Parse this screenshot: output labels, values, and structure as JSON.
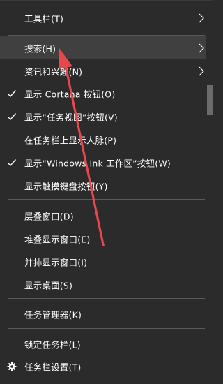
{
  "menu": {
    "items": [
      {
        "label": "工具栏(T)",
        "submenu": true
      },
      {
        "label": "搜索(H)",
        "submenu": true,
        "highlighted": true
      },
      {
        "label": "资讯和兴趣(N)",
        "submenu": true
      },
      {
        "label": "显示 Cortana 按钮(O)",
        "checked": true
      },
      {
        "label": "显示“任务视图”按钮(V)",
        "checked": true
      },
      {
        "label": "在任务栏上显示人脉(P)"
      },
      {
        "label": "显示“Windows Ink 工作区”按钮(W)",
        "checked": true
      },
      {
        "label": "显示触摸键盘按钮(Y)"
      },
      {
        "label": "层叠窗口(D)"
      },
      {
        "label": "堆叠显示窗口(E)"
      },
      {
        "label": "并排显示窗口(I)"
      },
      {
        "label": "显示桌面(S)"
      },
      {
        "label": "任务管理器(K)"
      },
      {
        "label": "锁定任务栏(L)"
      },
      {
        "label": "任务栏设置(T)",
        "icon": "gear-icon"
      }
    ]
  },
  "icons": {
    "check": "check-icon",
    "submenu": "chevron-right-icon",
    "settings": "gear-icon"
  },
  "colors": {
    "background": "#2b2b2b",
    "text": "#ffffff",
    "hover": "#404040",
    "separator": "#5a5a5a",
    "annotation_arrow": "#e8474b"
  }
}
